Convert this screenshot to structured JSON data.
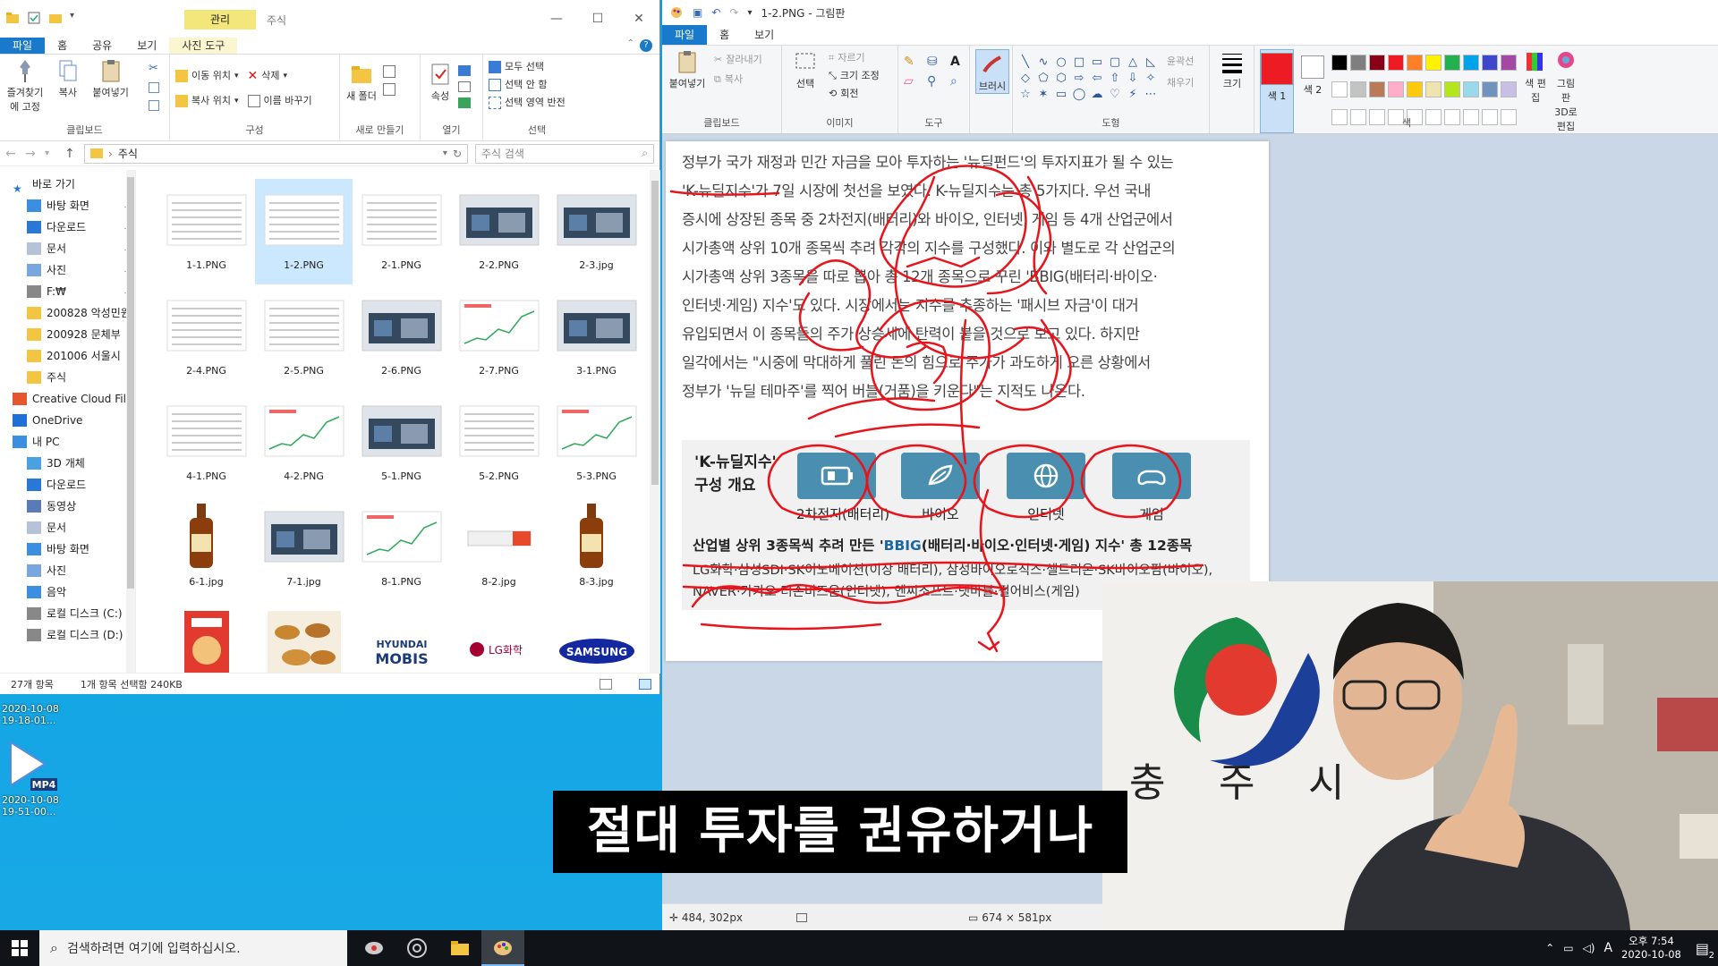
{
  "explorer": {
    "title": "주식",
    "context_tab_header": "관리",
    "tabs": [
      "파일",
      "홈",
      "공유",
      "보기",
      "사진 도구"
    ],
    "ribbon": {
      "clipboard": {
        "pin_label": "즐겨찾기에 고정",
        "copy_label": "복사",
        "paste_label": "붙여넣기",
        "group": "클립보드"
      },
      "organize": {
        "move_label": "이동 위치",
        "copy_to_label": "복사 위치",
        "delete_label": "삭제",
        "rename_label": "이름 바꾸기",
        "group": "구성"
      },
      "new": {
        "new_folder_label": "새 폴더",
        "group": "새로 만들기"
      },
      "open": {
        "properties_label": "속성",
        "group": "열기"
      },
      "select": {
        "select_all": "모두 선택",
        "select_none": "선택 안 함",
        "invert": "선택 영역 반전",
        "group": "선택"
      }
    },
    "address": "주식",
    "search_placeholder": "주식 검색",
    "nav": [
      {
        "label": "바로 가기",
        "icon": "star-icon",
        "pinned": false
      },
      {
        "label": "바탕 화면",
        "icon": "desktop-icon",
        "pinned": true
      },
      {
        "label": "다운로드",
        "icon": "download-icon",
        "pinned": true
      },
      {
        "label": "문서",
        "icon": "document-icon",
        "pinned": true
      },
      {
        "label": "사진",
        "icon": "picture-icon",
        "pinned": true
      },
      {
        "label": "F:₩",
        "icon": "drive-icon",
        "pinned": true
      },
      {
        "label": "200828 악성민원",
        "icon": "folder-icon",
        "pinned": false
      },
      {
        "label": "200928 문체부",
        "icon": "folder-icon",
        "pinned": false
      },
      {
        "label": "201006 서울시",
        "icon": "folder-icon",
        "pinned": false
      },
      {
        "label": "주식",
        "icon": "folder-icon",
        "pinned": false
      },
      {
        "label": "Creative Cloud Fil",
        "icon": "cloud-icon",
        "pinned": false
      },
      {
        "label": "OneDrive",
        "icon": "onedrive-icon",
        "pinned": false
      },
      {
        "label": "내 PC",
        "icon": "pc-icon",
        "pinned": false
      },
      {
        "label": "3D 개체",
        "icon": "cube-icon",
        "pinned": false
      },
      {
        "label": "다운로드",
        "icon": "download-icon",
        "pinned": false
      },
      {
        "label": "동영상",
        "icon": "video-icon",
        "pinned": false
      },
      {
        "label": "문서",
        "icon": "document-icon",
        "pinned": false
      },
      {
        "label": "바탕 화면",
        "icon": "desktop-icon",
        "pinned": false
      },
      {
        "label": "사진",
        "icon": "picture-icon",
        "pinned": false
      },
      {
        "label": "음악",
        "icon": "music-icon",
        "pinned": false
      },
      {
        "label": "로컬 디스크 (C:)",
        "icon": "drive-icon",
        "pinned": false
      },
      {
        "label": "로컬 디스크 (D:)",
        "icon": "drive-icon",
        "pinned": false
      }
    ],
    "files": [
      {
        "name": "1-1.PNG",
        "thumb": "doc"
      },
      {
        "name": "1-2.PNG",
        "thumb": "doc",
        "selected": true
      },
      {
        "name": "2-1.PNG",
        "thumb": "doc"
      },
      {
        "name": "2-2.PNG",
        "thumb": "photo"
      },
      {
        "name": "2-3.jpg",
        "thumb": "photo"
      },
      {
        "name": "2-4.PNG",
        "thumb": "doc"
      },
      {
        "name": "2-5.PNG",
        "thumb": "doc"
      },
      {
        "name": "2-6.PNG",
        "thumb": "photo"
      },
      {
        "name": "2-7.PNG",
        "thumb": "chart"
      },
      {
        "name": "3-1.PNG",
        "thumb": "photo"
      },
      {
        "name": "4-1.PNG",
        "thumb": "doc"
      },
      {
        "name": "4-2.PNG",
        "thumb": "chart"
      },
      {
        "name": "5-1.PNG",
        "thumb": "photo"
      },
      {
        "name": "5-2.PNG",
        "thumb": "doc"
      },
      {
        "name": "5-3.PNG",
        "thumb": "chart"
      },
      {
        "name": "6-1.jpg",
        "thumb": "bottle"
      },
      {
        "name": "7-1.jpg",
        "thumb": "photo"
      },
      {
        "name": "8-1.PNG",
        "thumb": "chart"
      },
      {
        "name": "8-2.jpg",
        "thumb": "tube"
      },
      {
        "name": "8-3.jpg",
        "thumb": "bottle"
      },
      {
        "name": "",
        "thumb": "snack"
      },
      {
        "name": "",
        "thumb": "food"
      },
      {
        "name": "",
        "thumb": "logo-mobis"
      },
      {
        "name": "",
        "thumb": "logo-lg"
      },
      {
        "name": "",
        "thumb": "logo-samsung"
      }
    ],
    "logos": {
      "mobis": "HYUNDAI MOBIS",
      "lg": "LG화학",
      "samsung": "SAMSUNG"
    },
    "status": {
      "count": "27개 항목",
      "selection": "1개 항목 선택함 240KB"
    }
  },
  "desktop": {
    "stamps": [
      "2020-10-08",
      "19-18-01...",
      "2020-10-08",
      "19-51-00..."
    ],
    "mp4_label": "MP4"
  },
  "paint": {
    "title": "1-2.PNG - 그림판",
    "tabs": [
      "파일",
      "홈",
      "보기"
    ],
    "ribbon": {
      "clipboard": {
        "paste": "붙여넣기",
        "cut": "잘라내기",
        "copy": "복사",
        "group": "클립보드"
      },
      "image": {
        "select": "선택",
        "crop": "자르기",
        "resize": "크기 조정",
        "rotate": "회전",
        "group": "이미지"
      },
      "tools": {
        "group": "도구"
      },
      "brushes": {
        "label": "브러시"
      },
      "shapes": {
        "outline": "윤곽선",
        "fill": "채우기",
        "group": "도형"
      },
      "size": {
        "label": "크기"
      },
      "color1": "색 1",
      "color2": "색 2",
      "edit_colors": "색 편집",
      "paint3d": "그림판 3D로 편집",
      "colors_group": "색"
    },
    "colors": {
      "color1": "#ed1c24",
      "color2": "#ffffff",
      "palette": [
        "#000000",
        "#7f7f7f",
        "#880015",
        "#ed1c24",
        "#ff7f27",
        "#fff200",
        "#22b14c",
        "#00a2e8",
        "#3f48cc",
        "#a349a4",
        "#ffffff",
        "#c3c3c3",
        "#b97a57",
        "#ffaec9",
        "#ffc90e",
        "#efe4b0",
        "#b5e61d",
        "#99d9ea",
        "#7092be",
        "#c8bfe7",
        "#ffffff",
        "#ffffff",
        "#ffffff",
        "#ffffff",
        "#ffffff",
        "#ffffff",
        "#ffffff",
        "#ffffff",
        "#ffffff",
        "#ffffff"
      ]
    },
    "article_lines": [
      "정부가 국가 재정과 민간 자금을 모아 투자하는 '뉴딜펀드'의 투자지표가 될 수 있는",
      "'K-뉴딜지수'가 7일 시장에 첫선을 보였다. K-뉴딜지수는 총 5가지다. 우선 국내",
      "증시에 상장된 종목 중 2차전지(배터리)와 바이오, 인터넷, 게임 등 4개 산업군에서",
      "시가총액 상위 10개 종목씩 추려 각각의 지수를 구성했다. 이와 별도로 각 산업군의",
      "시가총액 상위 3종목을 따로 뽑아 총 12개 종목으로 꾸린 'BBIG(배터리·바이오·",
      "인터넷·게임) 지수'도 있다. 시장에서는 지수를 추종하는 '패시브 자금'이 대거",
      "유입되면서 이 종목들의 주가 상승세에 탄력이 붙을 것으로 보고 있다. 하지만",
      "일각에서는 \"시중에 막대하게 풀린 돈의 힘으로 주가가 과도하게 오른 상황에서",
      "정부가 '뉴딜 테마주'를 찍어 버블(거품)을 키운다\"는 지적도 나온다."
    ],
    "infobox": {
      "title": "'K-뉴딜지수' 구성 개요",
      "categories": [
        {
          "label": "2차전지(배터리)",
          "icon": "battery-icon"
        },
        {
          "label": "바이오",
          "icon": "leaf-icon"
        },
        {
          "label": "인터넷",
          "icon": "globe-icon"
        },
        {
          "label": "게임",
          "icon": "gamepad-icon"
        }
      ],
      "subtitle_pre": "산업별 상위 3종목씩 추려 만든 '",
      "subtitle_blue": "BBIG",
      "subtitle_post": "(배터리·바이오·인터넷·게임) 지수' 총 12종목",
      "list_lines": [
        "LG화학·삼성SDI·SK이노베이션(이상 배터리), 삼성바이오로직스·셀트리온·SK바이오팜(바이오),",
        "NAVER·카카오·더존비즈온(인터넷), 엔씨소프트·넷마블·펄어비스(게임)"
      ]
    },
    "status": {
      "cursor": "484, 302px",
      "size": "674 × 581px"
    }
  },
  "webcam": {
    "sign_text": [
      "충",
      "주",
      "시"
    ]
  },
  "subtitle": "절대 투자를 권유하거나",
  "taskbar": {
    "search_placeholder": "검색하려면 여기에 입력하십시오.",
    "time": "오후 7:54",
    "date": "2020-10-08",
    "ime": "A",
    "notifications": "2"
  }
}
